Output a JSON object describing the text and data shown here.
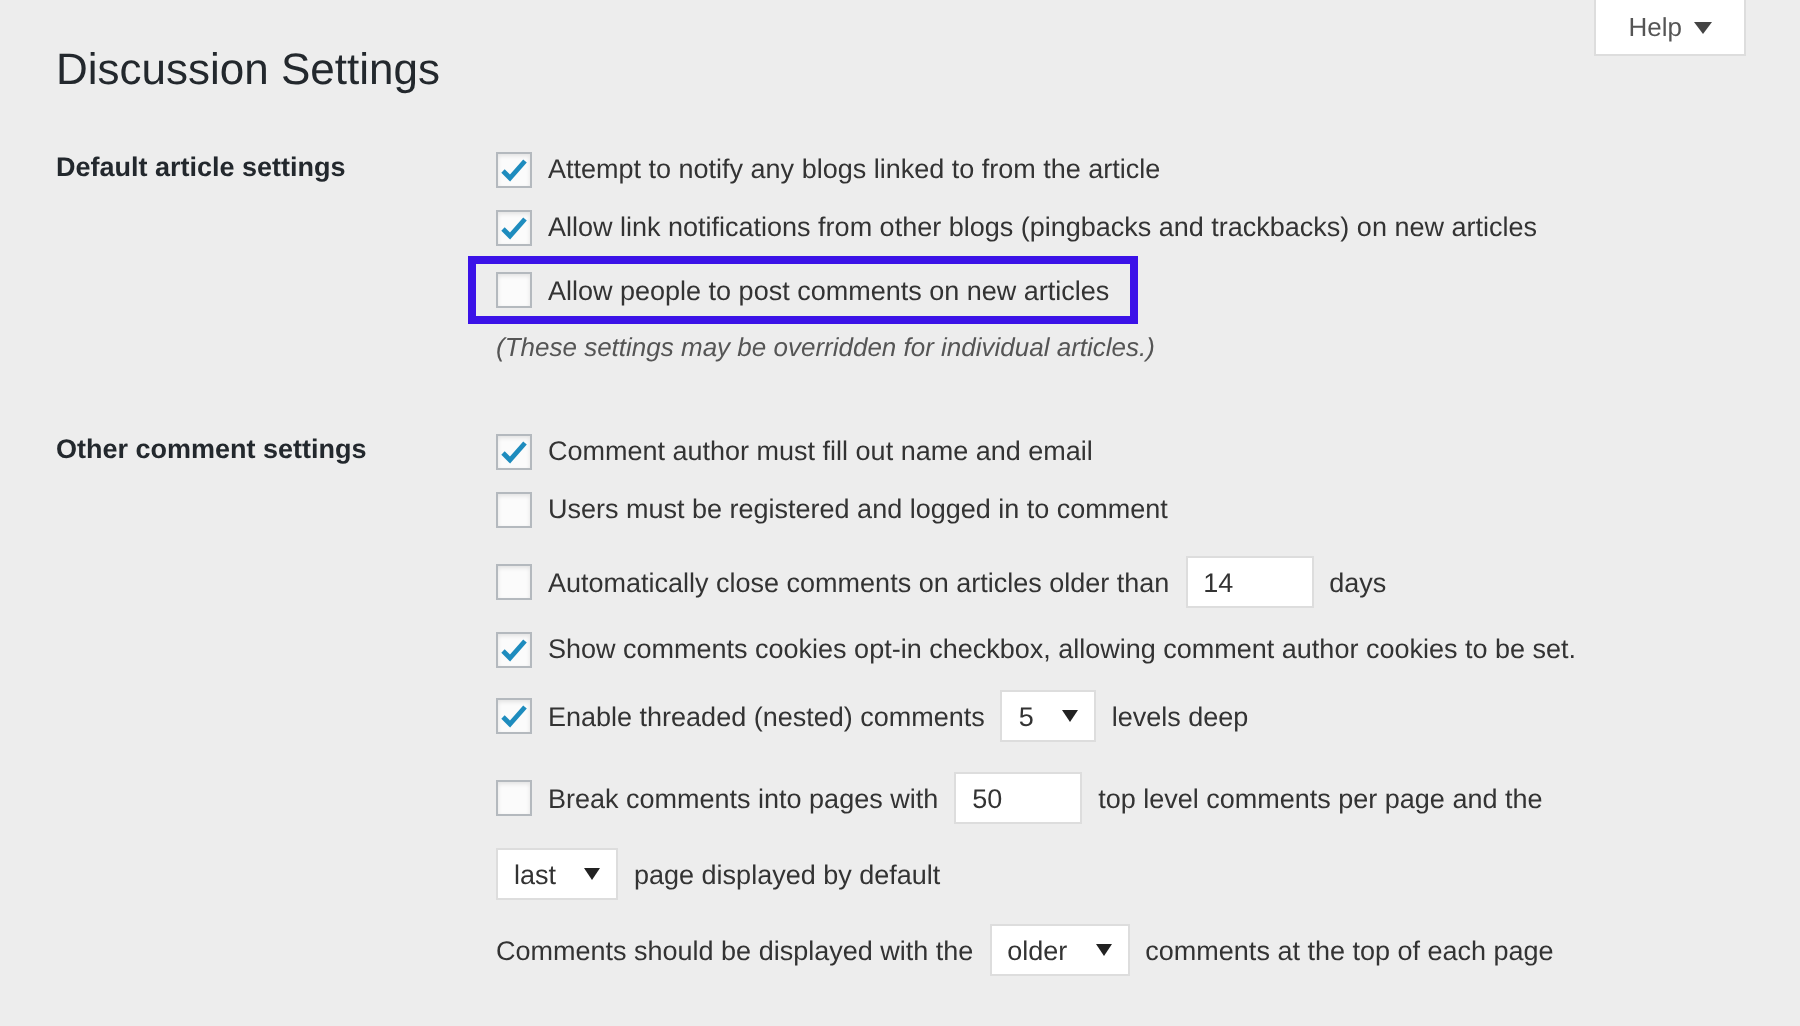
{
  "help_button": {
    "label": "Help"
  },
  "title": "Discussion Settings",
  "sections": [
    {
      "label": "Default article settings",
      "rows": [
        {
          "kind": "checkbox",
          "checked": true,
          "highlighted": false,
          "parts": [
            {
              "kind": "text",
              "text": "Attempt to notify any blogs linked to from the article"
            }
          ]
        },
        {
          "kind": "checkbox",
          "checked": true,
          "highlighted": false,
          "parts": [
            {
              "kind": "text",
              "text": "Allow link notifications from other blogs (pingbacks and trackbacks) on new articles"
            }
          ]
        },
        {
          "kind": "checkbox",
          "checked": false,
          "highlighted": true,
          "parts": [
            {
              "kind": "text",
              "text": "Allow people to post comments on new articles"
            }
          ]
        }
      ],
      "note": "(These settings may be overridden for individual articles.)"
    },
    {
      "label": "Other comment settings",
      "rows": [
        {
          "kind": "checkbox",
          "checked": true,
          "highlighted": false,
          "parts": [
            {
              "kind": "text",
              "text": "Comment author must fill out name and email"
            }
          ]
        },
        {
          "kind": "checkbox",
          "checked": false,
          "highlighted": false,
          "parts": [
            {
              "kind": "text",
              "text": "Users must be registered and logged in to comment"
            }
          ]
        },
        {
          "kind": "checkbox",
          "checked": false,
          "highlighted": false,
          "parts": [
            {
              "kind": "text",
              "text": "Automatically close comments on articles older than"
            },
            {
              "kind": "input",
              "value": "14"
            },
            {
              "kind": "text",
              "text": "days"
            }
          ]
        },
        {
          "kind": "checkbox",
          "checked": true,
          "highlighted": false,
          "parts": [
            {
              "kind": "text",
              "text": "Show comments cookies opt-in checkbox, allowing comment author cookies to be set."
            }
          ]
        },
        {
          "kind": "checkbox",
          "checked": true,
          "highlighted": false,
          "parts": [
            {
              "kind": "text",
              "text": "Enable threaded (nested) comments"
            },
            {
              "kind": "select",
              "value": "5"
            },
            {
              "kind": "text",
              "text": "levels deep"
            }
          ]
        },
        {
          "kind": "checkbox",
          "checked": false,
          "highlighted": false,
          "parts": [
            {
              "kind": "text",
              "text": "Break comments into pages with"
            },
            {
              "kind": "input",
              "value": "50"
            },
            {
              "kind": "text",
              "text": "top level comments per page and the"
            }
          ]
        },
        {
          "kind": "plain",
          "parts": [
            {
              "kind": "select",
              "value": "last"
            },
            {
              "kind": "text",
              "text": "page displayed by default"
            }
          ]
        },
        {
          "kind": "plain",
          "parts": [
            {
              "kind": "text",
              "text": "Comments should be displayed with the"
            },
            {
              "kind": "select",
              "value": "older"
            },
            {
              "kind": "text",
              "text": "comments at the top of each page"
            }
          ]
        }
      ]
    }
  ]
}
